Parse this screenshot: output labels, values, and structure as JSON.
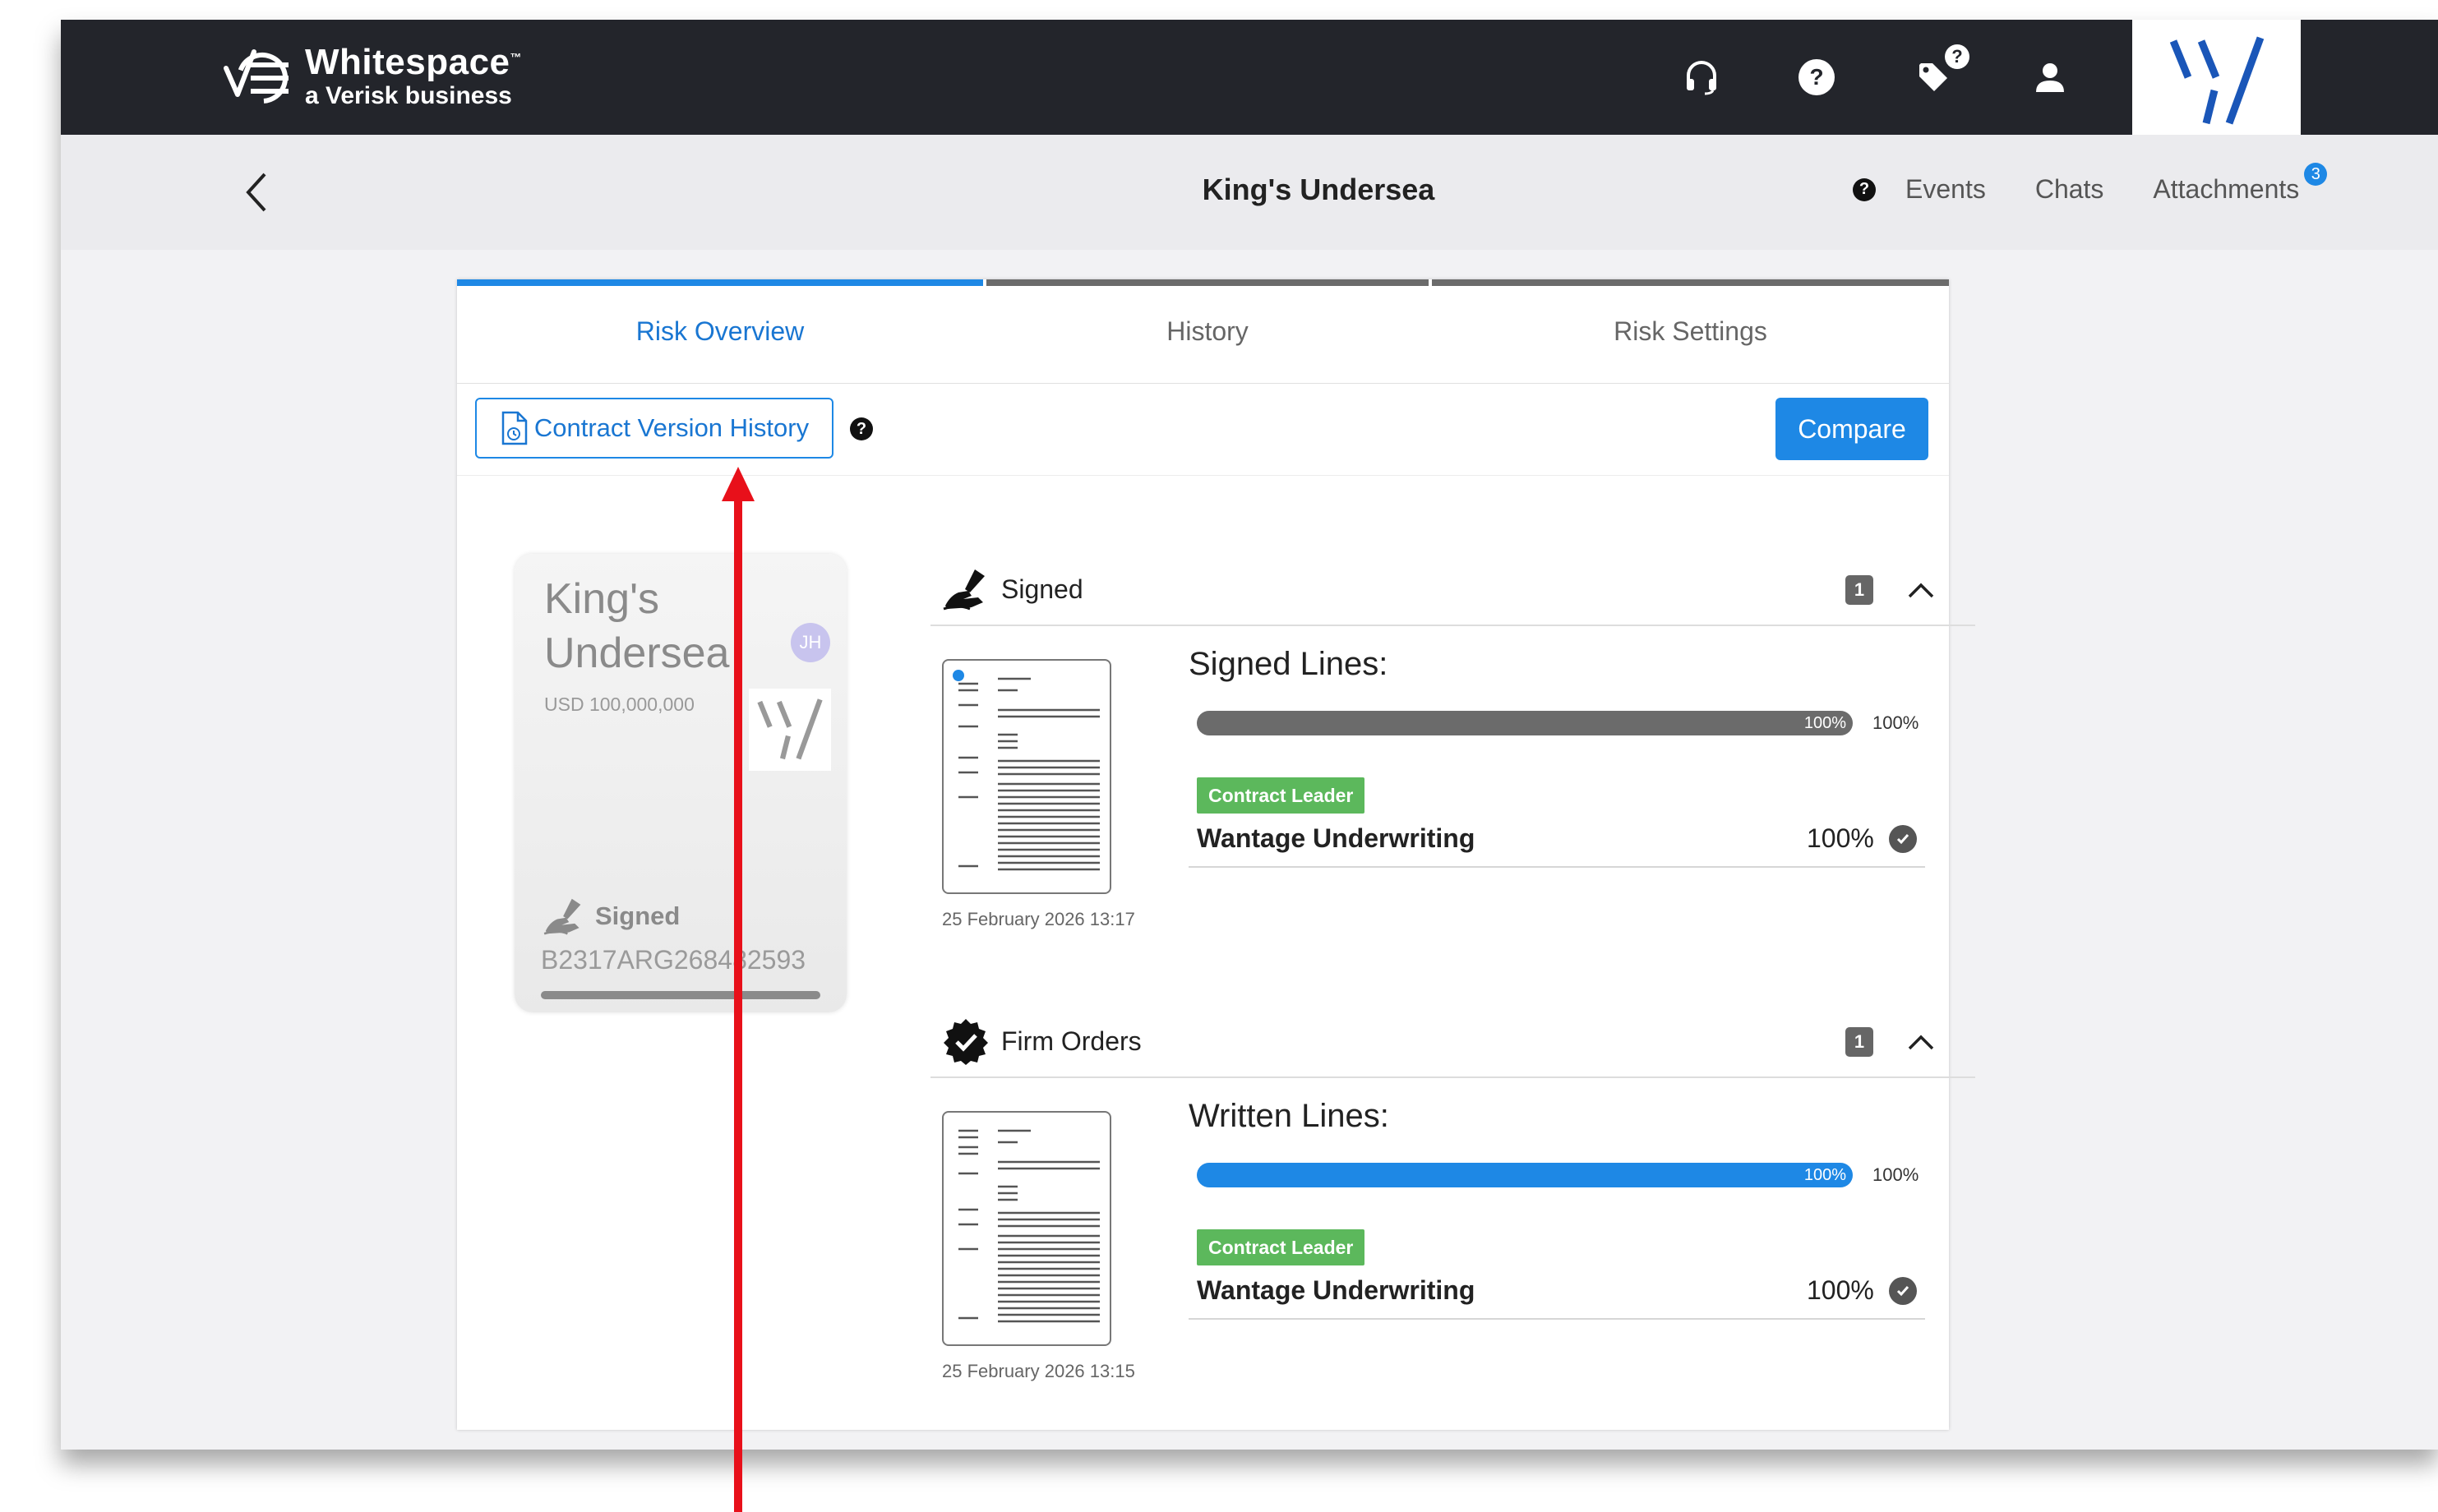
{
  "app": {
    "brand_name": "Whitespace",
    "brand_tm": "™",
    "brand_tagline": "a Verisk business",
    "colors": {
      "topbar": "#23252b",
      "accent": "#1e88e5",
      "leader_badge": "#5cb85c",
      "annotation_arrow": "#e8101a"
    }
  },
  "topbar": {
    "icons": [
      "headset-icon",
      "help-icon",
      "tag-icon",
      "user-icon"
    ],
    "tag_badge": "?"
  },
  "header": {
    "title": "King's Undersea",
    "help_glyph": "?",
    "nav": {
      "events": "Events",
      "chats": "Chats",
      "attachments": "Attachments",
      "attachments_count": "3"
    }
  },
  "tabs": [
    {
      "label": "Risk Overview",
      "active": true
    },
    {
      "label": "History",
      "active": false
    },
    {
      "label": "Risk Settings",
      "active": false
    }
  ],
  "toolbar": {
    "contract_version_history": "Contract Version History",
    "help_glyph": "?",
    "compare": "Compare"
  },
  "risk_card": {
    "title": "King's Undersea",
    "avatar_initials": "JH",
    "amount": "USD 100,000,000",
    "status": "Signed",
    "reference": "B2317ARG268482593"
  },
  "sections": [
    {
      "title": "Signed",
      "icon": "signing-hand-icon",
      "count": "1",
      "doc_date": "25 February 2026 13:17",
      "lines_title": "Signed Lines:",
      "progress": 1.0,
      "progress_label_inner": "100%",
      "progress_label_outer": "100%",
      "progress_color": "#6b6b6b",
      "role_badge": "Contract Leader",
      "underwriter": "Wantage Underwriting",
      "underwriter_pct": "100%"
    },
    {
      "title": "Firm Orders",
      "icon": "verified-badge-icon",
      "count": "1",
      "doc_date": "25 February 2026 13:15",
      "lines_title": "Written Lines:",
      "progress": 1.0,
      "progress_label_inner": "100%",
      "progress_label_outer": "100%",
      "progress_color": "#1e88e5",
      "role_badge": "Contract Leader",
      "underwriter": "Wantage Underwriting",
      "underwriter_pct": "100%"
    }
  ]
}
